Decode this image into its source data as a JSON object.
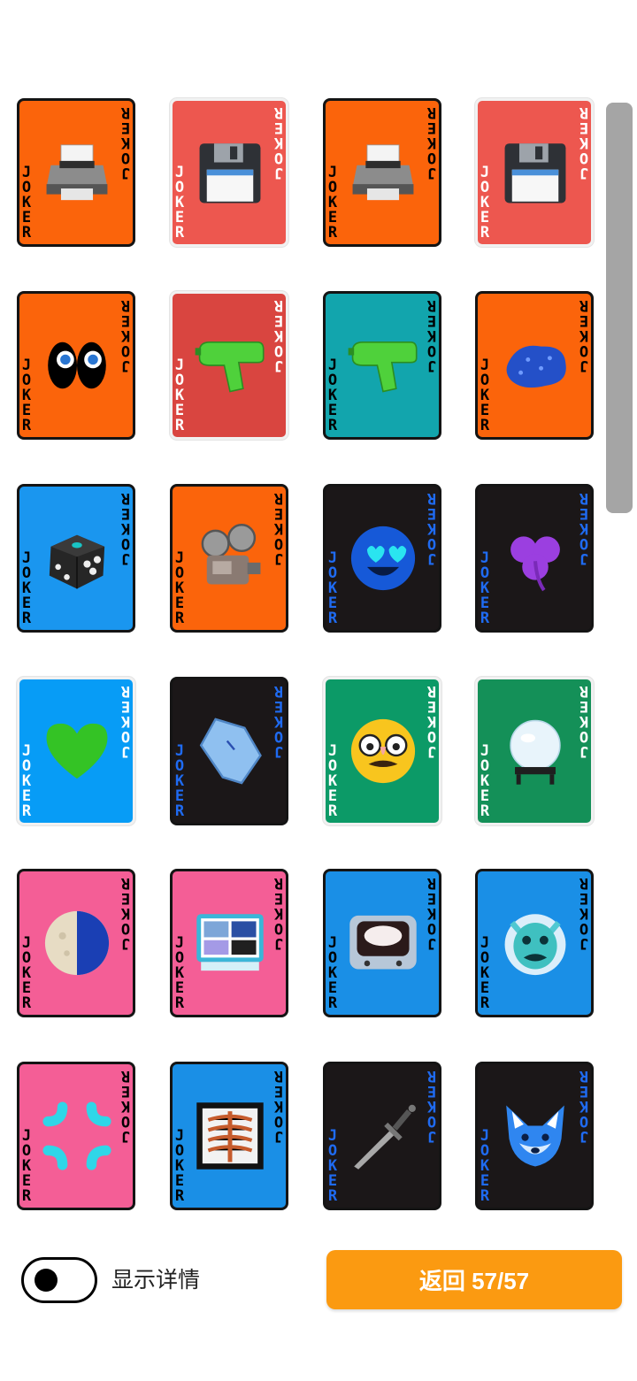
{
  "card_label": "JOKER",
  "cards": [
    {
      "icon": "printer-icon",
      "bg": "#fb640b",
      "label_color": "#000000",
      "border": "black"
    },
    {
      "icon": "floppy-disk-icon",
      "bg": "#ed574f",
      "label_color": "#ffffff",
      "border": "white"
    },
    {
      "icon": "printer-icon",
      "bg": "#fb640b",
      "label_color": "#000000",
      "border": "black"
    },
    {
      "icon": "floppy-disk-icon",
      "bg": "#ed574f",
      "label_color": "#ffffff",
      "border": "white"
    },
    {
      "icon": "eyes-icon",
      "bg": "#fb640b",
      "label_color": "#000000",
      "border": "black"
    },
    {
      "icon": "water-pistol-icon",
      "bg": "#d94540",
      "label_color": "#ffffff",
      "border": "white"
    },
    {
      "icon": "water-pistol-icon",
      "bg": "#12a5ad",
      "label_color": "#000000",
      "border": "black"
    },
    {
      "icon": "sponge-icon",
      "bg": "#fb640b",
      "label_color": "#000000",
      "border": "black"
    },
    {
      "icon": "die-icon",
      "bg": "#1a96ef",
      "label_color": "#000000",
      "border": "black"
    },
    {
      "icon": "film-projector-icon",
      "bg": "#fb640b",
      "label_color": "#000000",
      "border": "black"
    },
    {
      "icon": "heart-eyes-face-icon",
      "bg": "#1b1718",
      "label_color": "#1f6bf2",
      "border": "black"
    },
    {
      "icon": "shamrock-icon",
      "bg": "#1b1718",
      "label_color": "#1f6bf2",
      "border": "black"
    },
    {
      "icon": "green-heart-icon",
      "bg": "#079cf6",
      "label_color": "#ffffff",
      "border": "white"
    },
    {
      "icon": "coffin-icon",
      "bg": "#1b1718",
      "label_color": "#1f6bf2",
      "border": "black"
    },
    {
      "icon": "disguised-face-icon",
      "bg": "#0c9a67",
      "label_color": "#ffffff",
      "border": "white"
    },
    {
      "icon": "crystal-ball-icon",
      "bg": "#149058",
      "label_color": "#ffffff",
      "border": "white"
    },
    {
      "icon": "moon-icon",
      "bg": "#f45e96",
      "label_color": "#000000",
      "border": "black"
    },
    {
      "icon": "bento-box-icon",
      "bg": "#f45e96",
      "label_color": "#000000",
      "border": "black"
    },
    {
      "icon": "television-icon",
      "bg": "#1a8fe6",
      "label_color": "#000000",
      "border": "black"
    },
    {
      "icon": "ogre-mask-icon",
      "bg": "#1a8fe6",
      "label_color": "#000000",
      "border": "black"
    },
    {
      "icon": "anger-symbol-icon",
      "bg": "#f45e96",
      "label_color": "#000000",
      "border": "black"
    },
    {
      "icon": "x-ray-icon",
      "bg": "#1a8fe6",
      "label_color": "#000000",
      "border": "black"
    },
    {
      "icon": "dagger-icon",
      "bg": "#1b1718",
      "label_color": "#1f6bf2",
      "border": "black"
    },
    {
      "icon": "fox-face-icon",
      "bg": "#1b1718",
      "label_color": "#1f6bf2",
      "border": "black"
    }
  ],
  "footer": {
    "toggle_label": "显示详情",
    "back_button_label": "返回 57/57"
  }
}
